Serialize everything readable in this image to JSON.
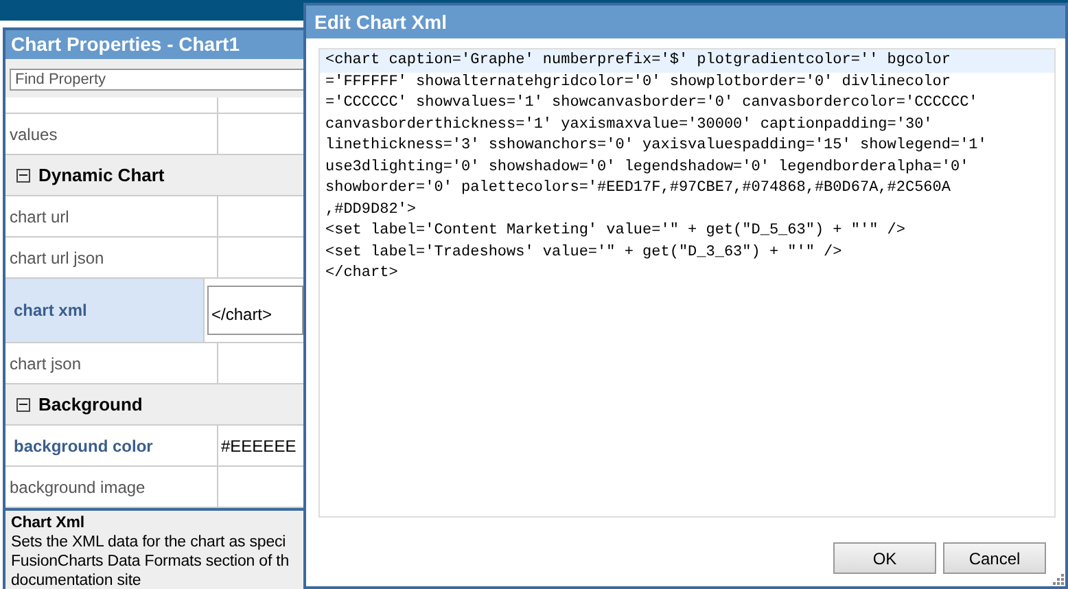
{
  "properties_panel": {
    "title": "Chart Properties - Chart1",
    "search": {
      "placeholder": "Find Property"
    },
    "rows": [
      {
        "kind": "blank"
      },
      {
        "kind": "property",
        "label": "values",
        "value": "",
        "selected": false,
        "modified": false
      },
      {
        "kind": "section",
        "label": "Dynamic Chart",
        "expanded": true
      },
      {
        "kind": "property",
        "label": "chart url",
        "value": "",
        "selected": false,
        "modified": false
      },
      {
        "kind": "property",
        "label": "chart url json",
        "value": "",
        "selected": false,
        "modified": false
      },
      {
        "kind": "property",
        "label": "chart xml",
        "value": "</chart>",
        "selected": true,
        "modified": true
      },
      {
        "kind": "property",
        "label": "chart json",
        "value": "",
        "selected": false,
        "modified": false
      },
      {
        "kind": "section",
        "label": "Background",
        "expanded": true
      },
      {
        "kind": "property",
        "label": "background color",
        "value": "#EEEEEE",
        "selected": false,
        "modified": true
      },
      {
        "kind": "property",
        "label": "background image",
        "value": "",
        "selected": false,
        "modified": false
      }
    ],
    "help": {
      "title": "Chart Xml",
      "lines": [
        "Sets the XML data for the chart as speci",
        "FusionCharts Data Formats section of th",
        "documentation site"
      ]
    }
  },
  "dialog": {
    "title": "Edit Chart Xml",
    "xml_lines": [
      "<chart caption='Graphe' numberprefix='$' plotgradientcolor='' bgcolor",
      "='FFFFFF' showalternatehgridcolor='0' showplotborder='0' divlinecolor",
      "='CCCCCC' showvalues='1' showcanvasborder='0' canvasbordercolor='CCCCCC'",
      "canvasborderthickness='1' yaxismaxvalue='30000' captionpadding='30'",
      "linethickness='3' sshowanchors='0' yaxisvaluespadding='15' showlegend='1'",
      "use3dlighting='0' showshadow='0' legendshadow='0' legendborderalpha='0'",
      "showborder='0' palettecolors='#EED17F,#97CBE7,#074868,#B0D67A,#2C560A",
      ",#DD9D82'>",
      "<set label='Content Marketing' value='\" + get(\"D_5_63\") + \"'\" />",
      "<set label='Tradeshows' value='\" + get(\"D_3_63\") + \"'\" />",
      "</chart>"
    ],
    "buttons": [
      "OK",
      "Cancel"
    ]
  }
}
